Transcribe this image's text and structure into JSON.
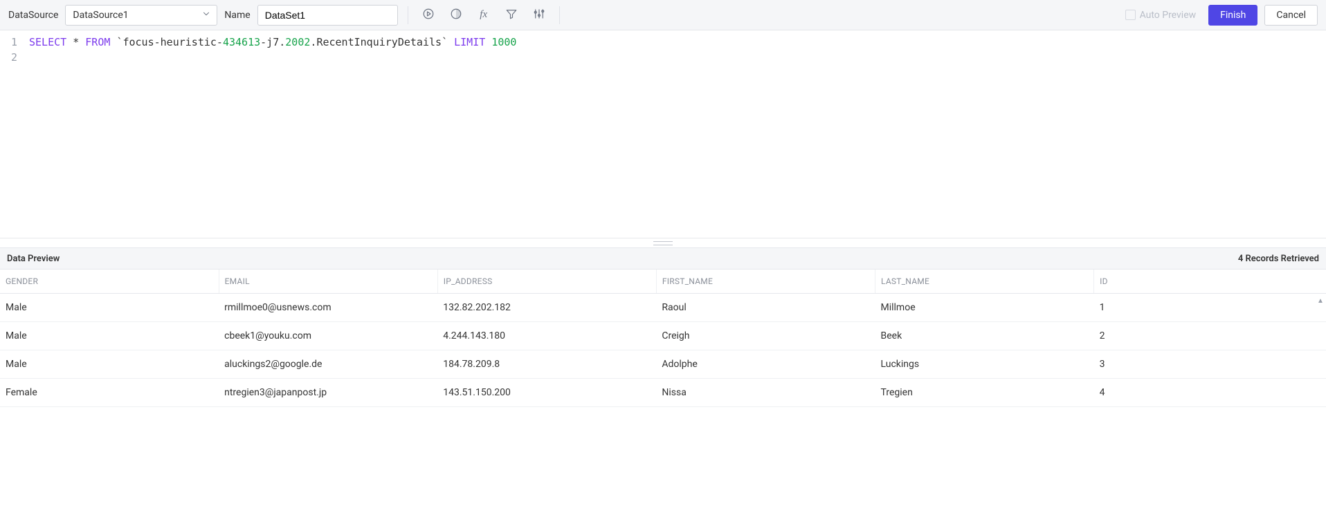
{
  "toolbar": {
    "datasource_label": "DataSource",
    "datasource_value": "DataSource1",
    "name_label": "Name",
    "name_value": "DataSet1",
    "auto_preview_label": "Auto Preview",
    "finish_label": "Finish",
    "cancel_label": "Cancel",
    "icons": {
      "run": "run-icon",
      "preview": "preview-contrast-icon",
      "fx": "fx-icon",
      "filter": "filter-icon",
      "sliders": "sliders-icon"
    }
  },
  "editor": {
    "lines": [
      "1",
      "2"
    ],
    "sql": {
      "kw1": "SELECT",
      "star": "*",
      "kw2": "FROM",
      "btick_open": "`",
      "ident_a": "focus-heuristic-",
      "ident_num1": "434613",
      "ident_b": "-j7",
      "dot1": ".",
      "ident_num2": "2002",
      "dot2": ".",
      "ident_c": "RecentInquiryDetails",
      "btick_close": "`",
      "kw3": "LIMIT",
      "num": "1000"
    }
  },
  "preview": {
    "title": "Data Preview",
    "count_text": "4 Records Retrieved",
    "columns": [
      "GENDER",
      "EMAIL",
      "IP_ADDRESS",
      "FIRST_NAME",
      "LAST_NAME",
      "ID"
    ],
    "rows": [
      {
        "gender": "Male",
        "email": "rmillmoe0@usnews.com",
        "ip": "132.82.202.182",
        "first": "Raoul",
        "last": "Millmoe",
        "id": "1"
      },
      {
        "gender": "Male",
        "email": "cbeek1@youku.com",
        "ip": "4.244.143.180",
        "first": "Creigh",
        "last": "Beek",
        "id": "2"
      },
      {
        "gender": "Male",
        "email": "aluckings2@google.de",
        "ip": "184.78.209.8",
        "first": "Adolphe",
        "last": "Luckings",
        "id": "3"
      },
      {
        "gender": "Female",
        "email": "ntregien3@japanpost.jp",
        "ip": "143.51.150.200",
        "first": "Nissa",
        "last": "Tregien",
        "id": "4"
      }
    ]
  }
}
